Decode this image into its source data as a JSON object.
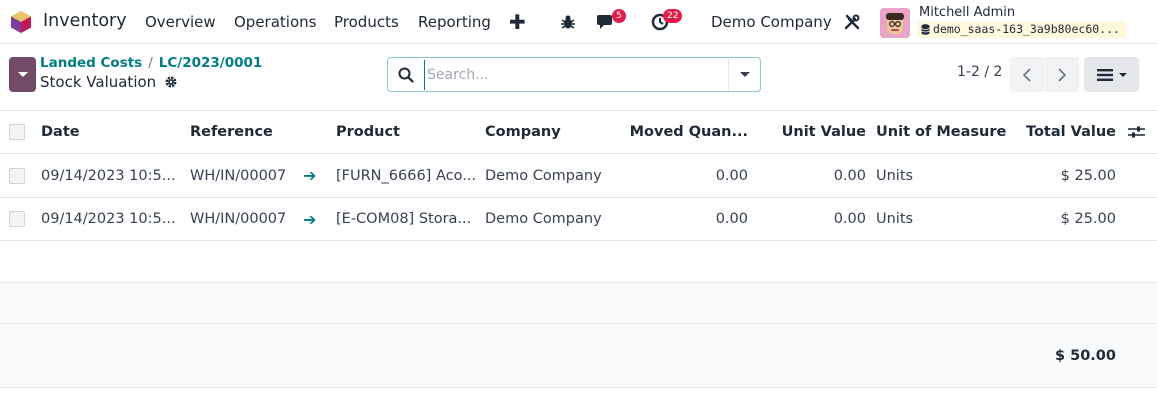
{
  "navbar": {
    "app_name": "Inventory",
    "menu": [
      "Overview",
      "Operations",
      "Products",
      "Reporting"
    ],
    "messages_count": "5",
    "activities_count": "22",
    "company": "Demo Company",
    "user_name": "Mitchell Admin",
    "database": "demo_saas-163_3a9b80ec60..."
  },
  "control_panel": {
    "breadcrumb": [
      "Landed Costs",
      "LC/2023/0001"
    ],
    "title": "Stock Valuation",
    "search_placeholder": "Search...",
    "pager": "1-2 / 2"
  },
  "table": {
    "columns": [
      "Date",
      "Reference",
      "Product",
      "Company",
      "Moved Quan...",
      "Unit Value",
      "Unit of Measure",
      "Total Value"
    ],
    "rows": [
      {
        "date": "09/14/2023 10:5...",
        "reference": "WH/IN/00007",
        "product": "[FURN_6666] Aco...",
        "company": "Demo Company",
        "moved_qty": "0.00",
        "unit_value": "0.00",
        "uom": "Units",
        "total_value": "$ 25.00"
      },
      {
        "date": "09/14/2023 10:5...",
        "reference": "WH/IN/00007",
        "product": "[E-COM08] Stora...",
        "company": "Demo Company",
        "moved_qty": "0.00",
        "unit_value": "0.00",
        "uom": "Units",
        "total_value": "$ 25.00"
      }
    ],
    "total": "$ 50.00"
  },
  "colors": {
    "brand": "#714b67",
    "link": "#017e84",
    "badge": "#e11d48"
  }
}
